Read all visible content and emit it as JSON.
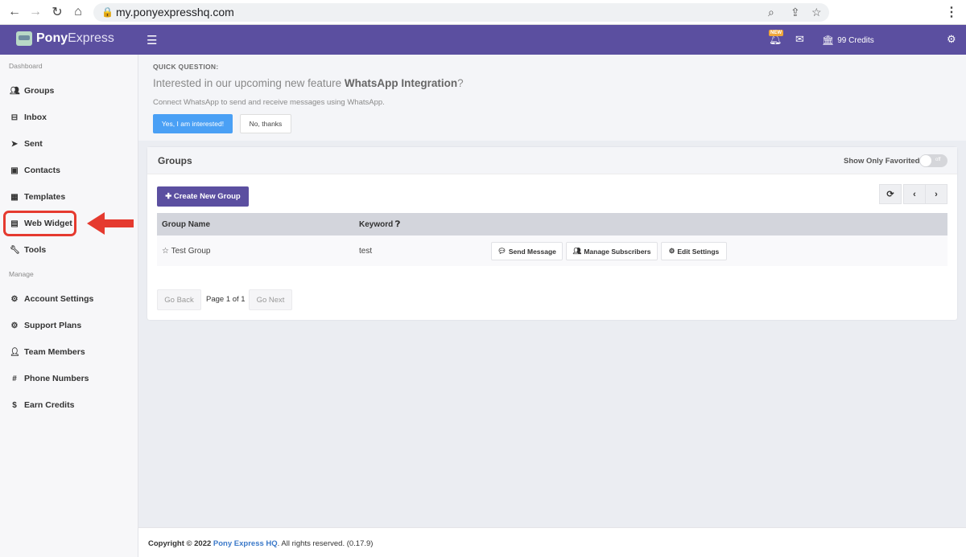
{
  "browser": {
    "url": "my.ponyexpresshq.com",
    "back_icon": "back-arrow-icon",
    "forward_icon": "forward-arrow-icon"
  },
  "topnav": {
    "brand_bold": "Pony",
    "brand_light": "Express",
    "new_badge": "NEW",
    "credits": "99 Credits",
    "color": "#5b4fa0"
  },
  "sidebar": {
    "section_dashboard": "Dashboard",
    "section_manage": "Manage",
    "items": [
      {
        "label": "Groups",
        "icon": "users-icon"
      },
      {
        "label": "Inbox",
        "icon": "inbox-icon"
      },
      {
        "label": "Sent",
        "icon": "paper-plane-icon"
      },
      {
        "label": "Contacts",
        "icon": "address-book-icon"
      },
      {
        "label": "Templates",
        "icon": "templates-grid-icon"
      },
      {
        "label": "Web Widget",
        "icon": "widget-icon"
      },
      {
        "label": "Tools",
        "icon": "wrench-icon"
      }
    ],
    "manage_items": [
      {
        "label": "Account Settings",
        "icon": "gear-icon"
      },
      {
        "label": "Support Plans",
        "icon": "gear-icon"
      },
      {
        "label": "Team Members",
        "icon": "add-user-icon"
      },
      {
        "label": "Phone Numbers",
        "icon": "hash-icon"
      },
      {
        "label": "Earn Credits",
        "icon": "dollar-icon"
      }
    ]
  },
  "quick_question": {
    "label": "QUICK QUESTION:",
    "title_prefix": "Interested in our upcoming new feature ",
    "title_bold": "WhatsApp Integration",
    "title_suffix": "?",
    "subtitle": "Connect WhatsApp to send and receive messages using WhatsApp.",
    "yes_label": "Yes, I am interested!",
    "no_label": "No, thanks"
  },
  "groups_panel": {
    "title": "Groups",
    "favorite_label": "Show Only Favorited",
    "toggle_text": "off",
    "create_label": "Create New Group",
    "columns": [
      "Group Name",
      "Keyword"
    ],
    "rows": [
      {
        "name": "Test Group",
        "keyword": "test"
      }
    ],
    "row_actions": [
      "Send Message",
      "Manage Subscribers",
      "Edit Settings"
    ],
    "pagination": {
      "back": "Go Back",
      "page_text": "Page 1 of 1",
      "next": "Go Next"
    }
  },
  "footer": {
    "prefix": "Copyright © 2022 ",
    "link": "Pony Express HQ",
    "suffix": ". All rights reserved. (0.17.9)"
  }
}
